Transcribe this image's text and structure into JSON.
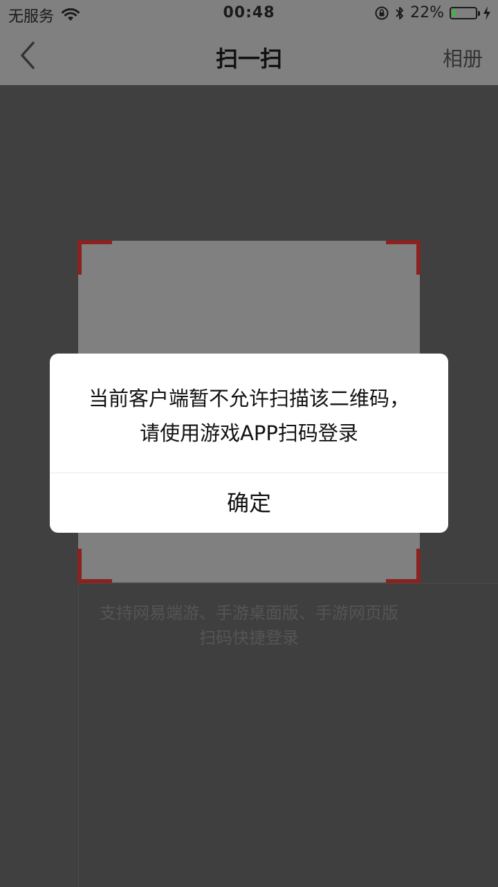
{
  "status_bar": {
    "carrier": "无服务",
    "time": "00:48",
    "battery_percent": "22%",
    "battery_level": 0.22,
    "battery_color": "#3fb43f",
    "icons": [
      "wifi-icon",
      "orientation-lock-icon",
      "bluetooth-icon",
      "battery-icon",
      "charging-icon"
    ]
  },
  "nav": {
    "back_icon": "chevron-left-icon",
    "title": "扫一扫",
    "album_label": "相册"
  },
  "scanner": {
    "corner_color": "#8b2222",
    "hint_line1": "支持网易端游、手游桌面版、手游网页版",
    "hint_line2": "扫码快捷登录"
  },
  "dialog": {
    "message_line1": "当前客户端暂不允许扫描该二维码，",
    "message_line2": "请使用游戏APP扫码登录",
    "confirm_label": "确定"
  }
}
